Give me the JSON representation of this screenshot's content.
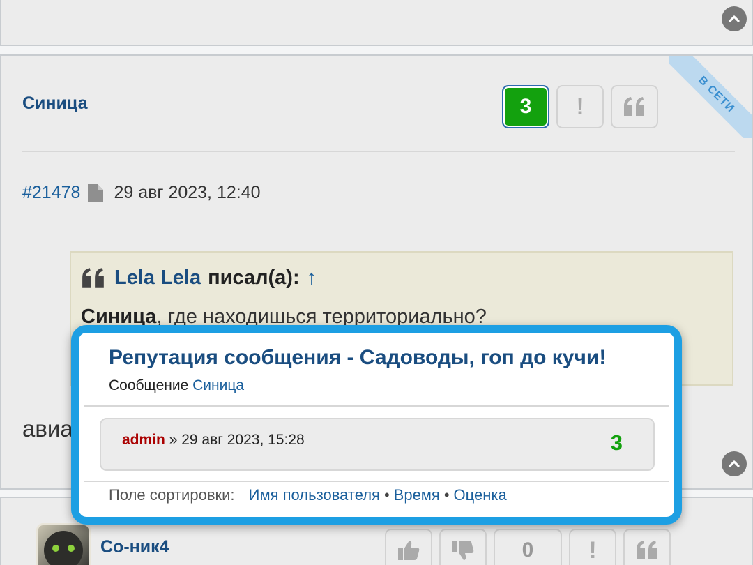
{
  "prev_post": {},
  "main_post": {
    "author": "Синица",
    "online_ribbon": "В СЕТИ",
    "reputation_value": "3",
    "report_label": "!",
    "post_number": "#21478",
    "datetime": "29 авг 2023, 12:40",
    "quote": {
      "author": "Lela Lela",
      "wrote": "писал(а):",
      "arrow": "↑",
      "addressee": "Синица",
      "text": ", где находишься территориально?"
    },
    "body_visible": "авиа"
  },
  "next_post": {
    "author": "Со-ник4",
    "rating": "0",
    "report_label": "!"
  },
  "popup": {
    "title": "Репутация сообщения - Садоводы, гоп до кучи!",
    "subtitle_prefix": "Сообщение",
    "subtitle_author": "Синица",
    "entries": [
      {
        "user": "admin",
        "separator": "»",
        "datetime": "29 авг 2023, 15:28",
        "score": "3"
      }
    ],
    "sort_label": "Поле сортировки:",
    "sort_options": [
      "Имя пользователя",
      "Время",
      "Оценка"
    ],
    "sort_separator": "•"
  },
  "colors": {
    "link": "#1a5f9c",
    "author": "#1a4d80",
    "positive": "#13a10e",
    "popup_border": "#1d9fe3",
    "admin": "#aa0000"
  },
  "icons": {
    "scroll_top": "chevron-up-circle-icon",
    "post_link": "document-icon",
    "quote": "quote-icon",
    "like": "thumbs-up-icon",
    "dislike": "thumbs-down-icon"
  }
}
